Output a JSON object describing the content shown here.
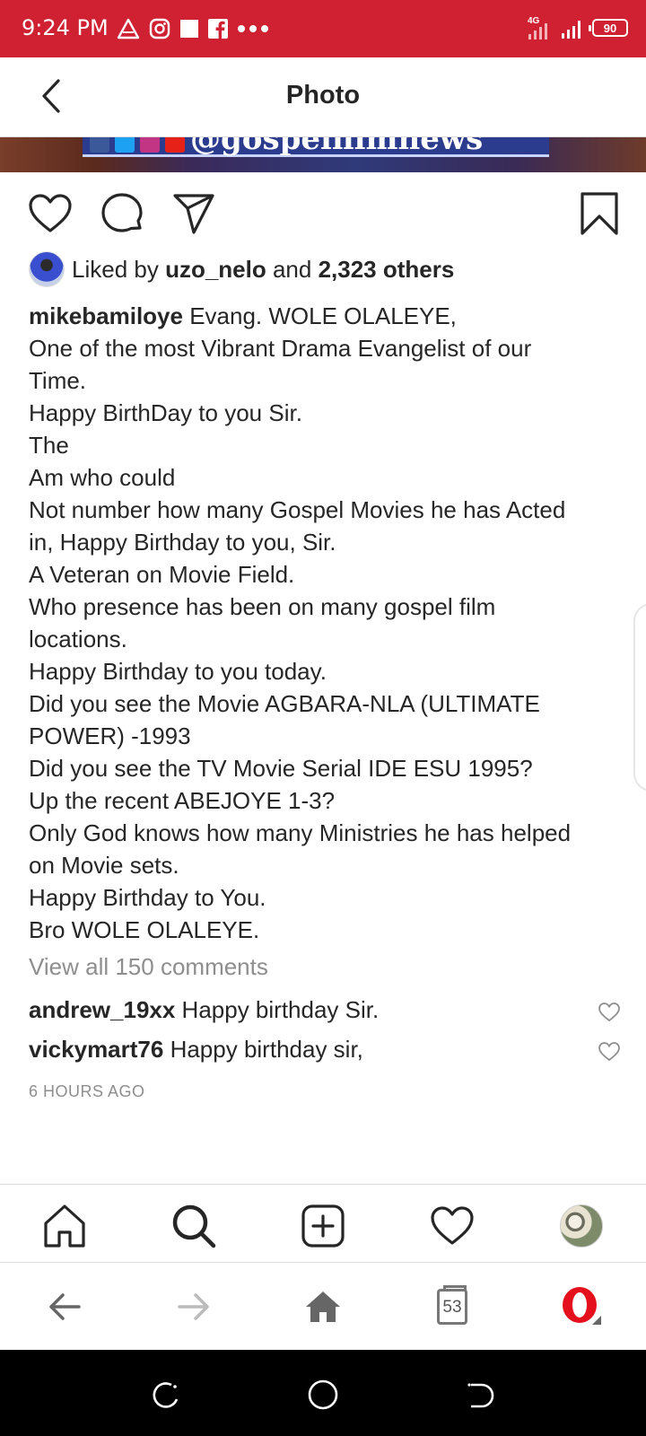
{
  "status_bar": {
    "time": "9:24 PM",
    "network": "4G",
    "battery": "90",
    "color": "#cf2132"
  },
  "header": {
    "title": "Photo",
    "back_icon": "chevron-left-icon"
  },
  "photo": {
    "banner_text": "@gospelfilmnews"
  },
  "actions": {
    "like_icon": "heart-icon",
    "comment_icon": "comment-icon",
    "share_icon": "send-icon",
    "save_icon": "bookmark-icon"
  },
  "likes": {
    "prefix": "Liked by ",
    "user": "uzo_nelo",
    "middle": " and ",
    "others": "2,323 others"
  },
  "caption": {
    "username": "mikebamiloye",
    "first_line": " Evang. WOLE OLALEYE,",
    "lines": [
      "One of the most Vibrant Drama Evangelist of our",
      "Time.",
      "Happy BirthDay to you Sir.",
      "The",
      "Am who could",
      "Not number how many Gospel Movies he has Acted",
      "in, Happy Birthday to you, Sir.",
      "A Veteran on Movie Field.",
      "Who presence has been on many gospel film",
      "locations.",
      "Happy Birthday to you today.",
      "Did you see the Movie AGBARA-NLA (ULTIMATE",
      "POWER) -1993",
      "Did you see the TV Movie Serial IDE ESU 1995?",
      "Up the recent ABEJOYE 1-3?",
      "Only God knows how many Ministries he has helped",
      "on Movie sets.",
      "Happy Birthday to You.",
      "Bro WOLE OLALEYE."
    ]
  },
  "comments": {
    "view_all": "View all 150 comments",
    "items": [
      {
        "user": "andrew_19xx",
        "text": " Happy birthday Sir."
      },
      {
        "user": "vickymart76",
        "text": " Happy birthday sir,"
      }
    ],
    "time_ago": "6 HOURS AGO"
  },
  "tab_bar": {
    "items": [
      "home-icon",
      "search-icon",
      "new-post-icon",
      "activity-heart-icon",
      "profile-avatar"
    ]
  },
  "browser_bar": {
    "tab_count": "53"
  }
}
